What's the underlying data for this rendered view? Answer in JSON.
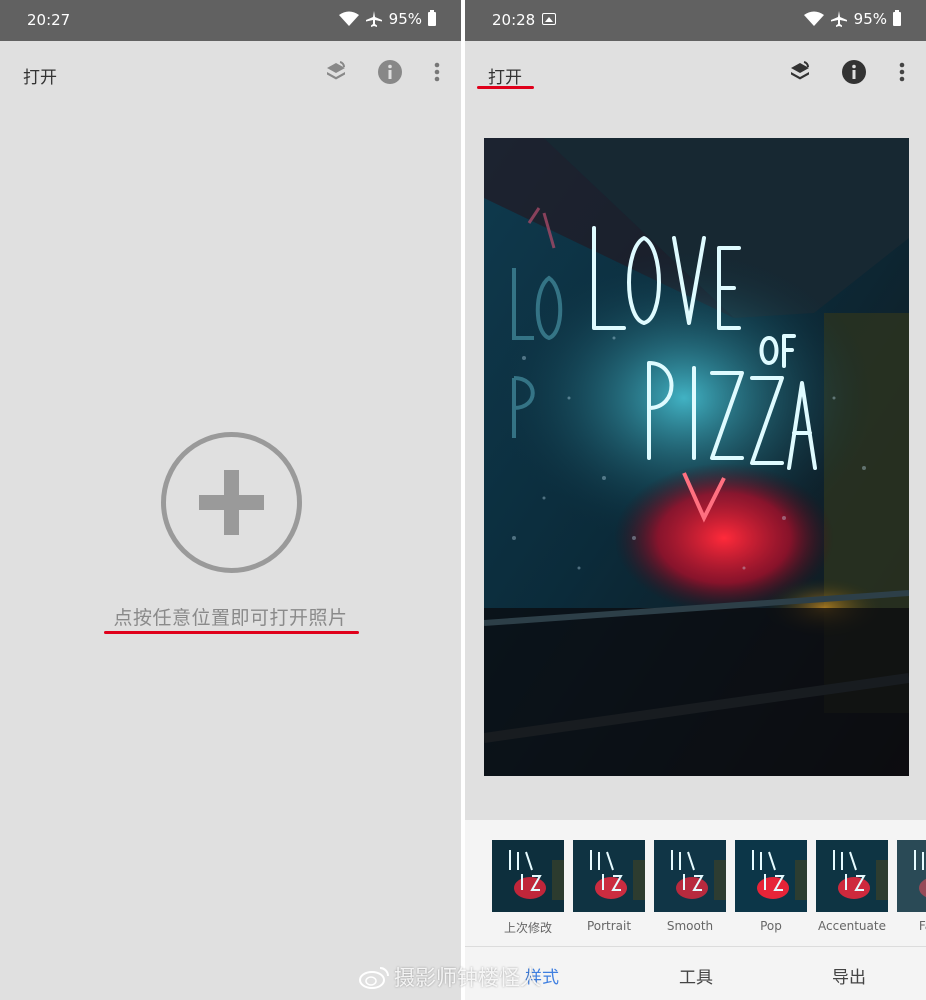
{
  "left_screen": {
    "status": {
      "time": "20:27",
      "battery": "95%"
    },
    "toolbar": {
      "title": "打开"
    },
    "hint": "点按任意位置即可打开照片"
  },
  "right_screen": {
    "status": {
      "time": "20:28",
      "battery": "95%"
    },
    "toolbar": {
      "title": "打开"
    },
    "thumbnails": [
      {
        "label": "上次修改"
      },
      {
        "label": "Portrait"
      },
      {
        "label": "Smooth"
      },
      {
        "label": "Pop"
      },
      {
        "label": "Accentuate"
      },
      {
        "label": "Fade"
      }
    ],
    "tabs": {
      "styles": "样式",
      "tools": "工具",
      "export": "导出"
    }
  },
  "watermark": "摄影师钟楼怪人",
  "colors": {
    "accent": "#3f7fe0",
    "annotation": "#e0001b",
    "statusbar": "#616161",
    "background": "#e0e0e0"
  }
}
